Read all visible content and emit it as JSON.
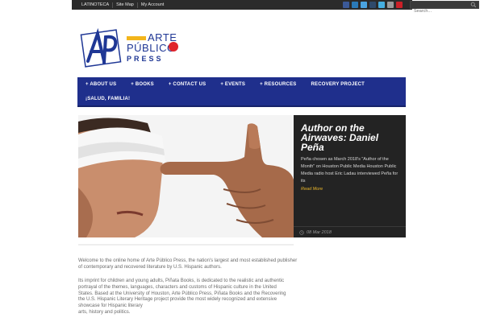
{
  "topbar": {
    "links": [
      "LATINOTECA",
      "Site Map",
      "My Account"
    ],
    "search_placeholder": "Search...",
    "social_icons": [
      {
        "name": "facebook-icon",
        "color": "#3b5998"
      },
      {
        "name": "linkedin-icon",
        "color": "#2a7ab8"
      },
      {
        "name": "twitter-icon",
        "color": "#4aa3df"
      },
      {
        "name": "tumblr-icon",
        "color": "#2f4a6b"
      },
      {
        "name": "vimeo-icon",
        "color": "#45aee0"
      },
      {
        "name": "email-icon",
        "color": "#9a9a9a"
      },
      {
        "name": "pinterest-icon",
        "color": "#cb2027"
      }
    ]
  },
  "logo": {
    "word_top": "ARTE",
    "word_mid": "PÚBLICO",
    "word_bottom": "PRESS",
    "colors": {
      "blue": "#1f3795",
      "yellow": "#f3b51b",
      "red": "#e0242b"
    }
  },
  "nav": {
    "row1": [
      "+ ABOUT US",
      "+ BOOKS",
      "+ CONTACT US",
      "+ EVENTS",
      "+ RESOURCES",
      "RECOVERY PROJECT"
    ],
    "row2": [
      "¡SALUD, FAMILIA!"
    ],
    "color": "#1f2f8c"
  },
  "slider": {
    "title": "Author on the Airwaves: Daniel Peña",
    "excerpt": "Peña chosen as March 2018's \"Author of the Month\" on Houston Public Media Houston Public Media radio host Eric Ladau interviewed Peña for its",
    "more_label": "Read More",
    "date": "08 Mar 2018"
  },
  "content": {
    "intro": "Welcome to the online home of Arte Público Press, the nation's largest and most established publisher of contemporary and recovered literature by U.S. Hispanic authors.",
    "imprint_lines": [
      "Its imprint for children and young adults, Piñata Books, is dedicated to the realistic and authentic",
      "portrayal of the themes, languages, characters and customs of Hispanic culture in the United",
      "States. Based at the University of Houston, Arte Público Press, Piñata Books and the Recovering",
      "the U.S. Hispanic Literary Heritage project provide the most widely recognized and extensive",
      "showcase for Hispanic literary",
      "arts, history and politics."
    ]
  }
}
